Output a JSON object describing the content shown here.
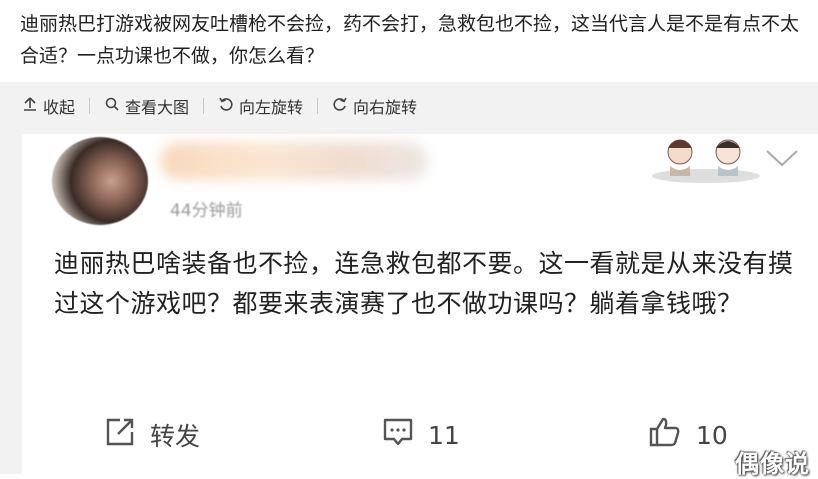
{
  "headline": "迪丽热巴打游戏被网友吐槽枪不会捡，药不会打，急救包也不捡，这当代言人是不是有点不太合适？一点功课也不做，你怎么看？",
  "toolbar": {
    "collapse": "收起",
    "view_large": "查看大图",
    "rotate_left": "向左旋转",
    "rotate_right": "向右旋转"
  },
  "post": {
    "time": "44分钟前",
    "text": "迪丽热巴啥装备也不捡，连急救包都不要。这一看就是从来没有摸过这个游戏吧？都要来表演赛了也不做功课吗？躺着拿钱哦？"
  },
  "actions": {
    "repost_label": "转发",
    "comment_count": "11",
    "like_count": "10"
  },
  "watermark": "偶像说",
  "icons": [
    "collapse-icon",
    "search-icon",
    "rotate-left-icon",
    "rotate-right-icon",
    "chevron-down-icon",
    "repost-icon",
    "comment-icon",
    "like-icon"
  ]
}
